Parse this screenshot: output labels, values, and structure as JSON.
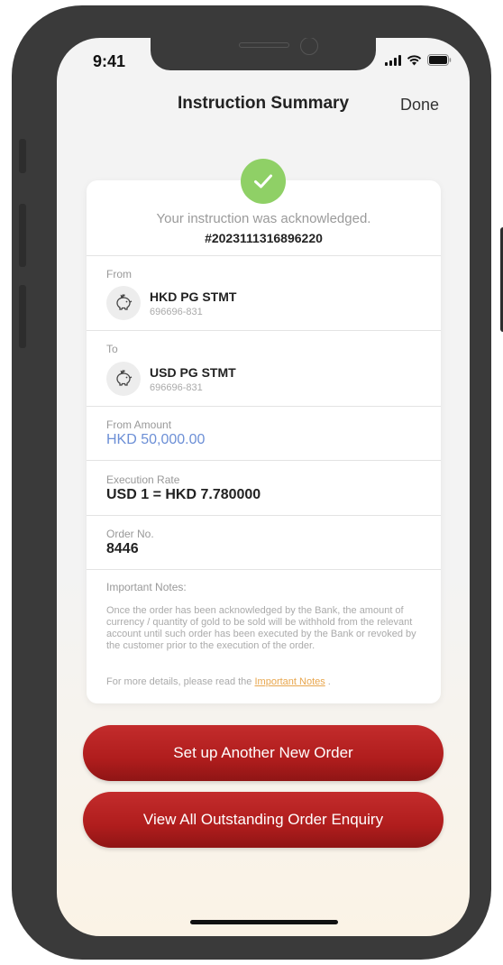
{
  "status_bar": {
    "time": "9:41"
  },
  "nav": {
    "title": "Instruction Summary",
    "done_label": "Done"
  },
  "summary": {
    "ack_text": "Your instruction was acknowledged.",
    "reference": "#2023111316896220",
    "from": {
      "label": "From",
      "account_name": "HKD PG STMT",
      "account_number": "696696-831"
    },
    "to": {
      "label": "To",
      "account_name": "USD PG STMT",
      "account_number": "696696-831"
    },
    "from_amount": {
      "label": "From Amount",
      "value": "HKD 50,000.00"
    },
    "execution_rate": {
      "label": "Execution Rate",
      "value": "USD 1 = HKD 7.780000"
    },
    "order_no": {
      "label": "Order No.",
      "value": "8446"
    },
    "notes": {
      "title": "Important Notes:",
      "body": "Once the order has been acknowledged by the Bank, the amount of currency / quantity of gold to be sold will be withhold from the relevant account until such order has been executed by the Bank or revoked by the customer prior to the execution of the order.",
      "more_prefix": "For more details, please read the",
      "more_link": "Important Notes",
      "more_suffix": " ."
    }
  },
  "actions": {
    "new_order_label": "Set up Another New Order",
    "view_outstanding_label": "View All Outstanding Order Enquiry"
  },
  "colors": {
    "success": "#8fd066",
    "primary_button": "#b01d1d",
    "amount_text": "#6c8fd6",
    "link": "#e8a64d"
  },
  "icons": {
    "check": "check-icon",
    "account": "piggy-bank-icon",
    "signal": "signal-icon",
    "wifi": "wifi-icon",
    "battery": "battery-icon"
  }
}
